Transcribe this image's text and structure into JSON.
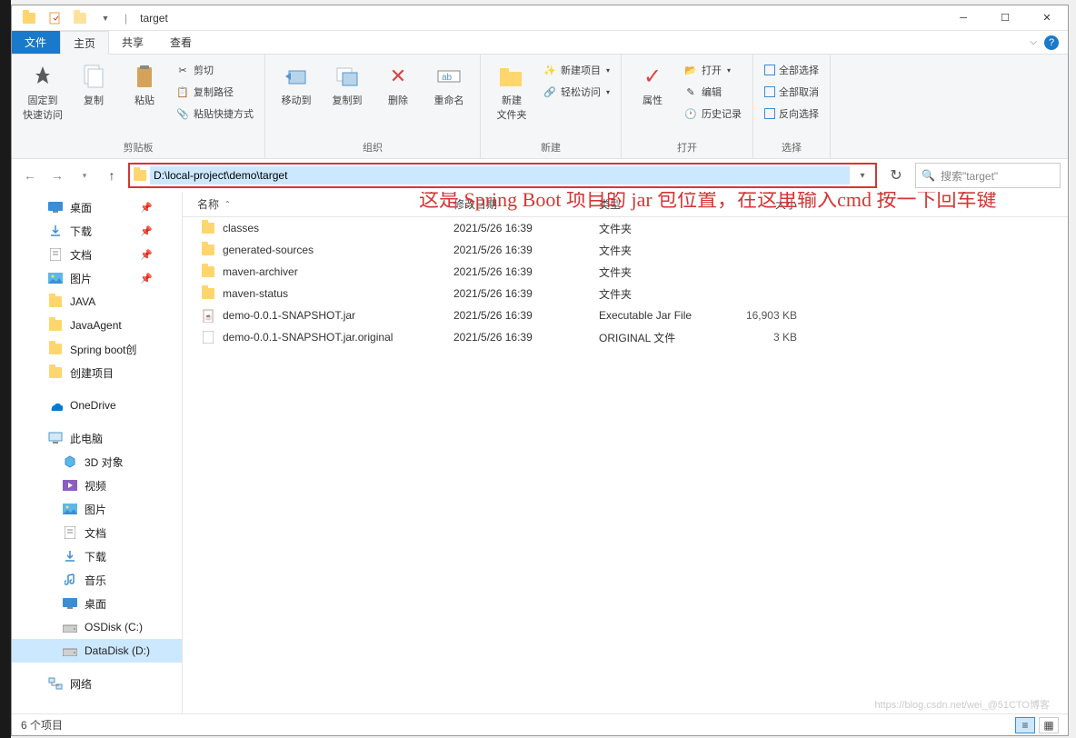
{
  "title": "target",
  "address_path": "D:\\local-project\\demo\\target",
  "search_placeholder": "搜索\"target\"",
  "tabs": {
    "file": "文件",
    "home": "主页",
    "share": "共享",
    "view": "查看"
  },
  "ribbon": {
    "clipboard": {
      "label": "剪贴板",
      "pin": "固定到\n快速访问",
      "copy": "复制",
      "paste": "粘贴",
      "cut": "剪切",
      "copy_path": "复制路径",
      "paste_shortcut": "粘贴快捷方式"
    },
    "organize": {
      "label": "组织",
      "move_to": "移动到",
      "copy_to": "复制到",
      "delete": "删除",
      "rename": "重命名"
    },
    "new": {
      "label": "新建",
      "new_folder": "新建\n文件夹",
      "new_item": "新建项目",
      "easy_access": "轻松访问"
    },
    "open": {
      "label": "打开",
      "properties": "属性",
      "open": "打开",
      "edit": "编辑",
      "history": "历史记录"
    },
    "select": {
      "label": "选择",
      "select_all": "全部选择",
      "select_none": "全部取消",
      "invert": "反向选择"
    }
  },
  "columns": {
    "name": "名称",
    "date": "修改日期",
    "type": "类型",
    "size": "大小"
  },
  "nav_items": [
    {
      "label": "桌面",
      "icon": "desktop",
      "pinned": true
    },
    {
      "label": "下载",
      "icon": "downloads",
      "pinned": true
    },
    {
      "label": "文档",
      "icon": "documents",
      "pinned": true
    },
    {
      "label": "图片",
      "icon": "pictures",
      "pinned": true
    },
    {
      "label": "JAVA",
      "icon": "folder",
      "pinned": false
    },
    {
      "label": "JavaAgent",
      "icon": "folder",
      "pinned": false
    },
    {
      "label": "Spring boot创",
      "icon": "folder",
      "pinned": false
    },
    {
      "label": "创建项目",
      "icon": "folder",
      "pinned": false
    }
  ],
  "onedrive": "OneDrive",
  "this_pc": "此电脑",
  "pc_items": [
    {
      "label": "3D 对象",
      "icon": "3d"
    },
    {
      "label": "视频",
      "icon": "video"
    },
    {
      "label": "图片",
      "icon": "pictures"
    },
    {
      "label": "文档",
      "icon": "documents"
    },
    {
      "label": "下载",
      "icon": "downloads"
    },
    {
      "label": "音乐",
      "icon": "music"
    },
    {
      "label": "桌面",
      "icon": "desktop"
    },
    {
      "label": "OSDisk (C:)",
      "icon": "disk"
    },
    {
      "label": "DataDisk (D:)",
      "icon": "disk",
      "selected": true
    }
  ],
  "network": "网络",
  "files": [
    {
      "name": "classes",
      "date": "2021/5/26 16:39",
      "type": "文件夹",
      "size": "",
      "icon": "folder"
    },
    {
      "name": "generated-sources",
      "date": "2021/5/26 16:39",
      "type": "文件夹",
      "size": "",
      "icon": "folder"
    },
    {
      "name": "maven-archiver",
      "date": "2021/5/26 16:39",
      "type": "文件夹",
      "size": "",
      "icon": "folder"
    },
    {
      "name": "maven-status",
      "date": "2021/5/26 16:39",
      "type": "文件夹",
      "size": "",
      "icon": "folder"
    },
    {
      "name": "demo-0.0.1-SNAPSHOT.jar",
      "date": "2021/5/26 16:39",
      "type": "Executable Jar File",
      "size": "16,903 KB",
      "icon": "jar"
    },
    {
      "name": "demo-0.0.1-SNAPSHOT.jar.original",
      "date": "2021/5/26 16:39",
      "type": "ORIGINAL 文件",
      "size": "3 KB",
      "icon": "file"
    }
  ],
  "status": "6 个项目",
  "annotation": "这是 Spring Boot 项目的 jar 包位置，在这里输入cmd 按一下回车键",
  "watermark": "https://blog.csdn.net/wei_@51CTO博客"
}
